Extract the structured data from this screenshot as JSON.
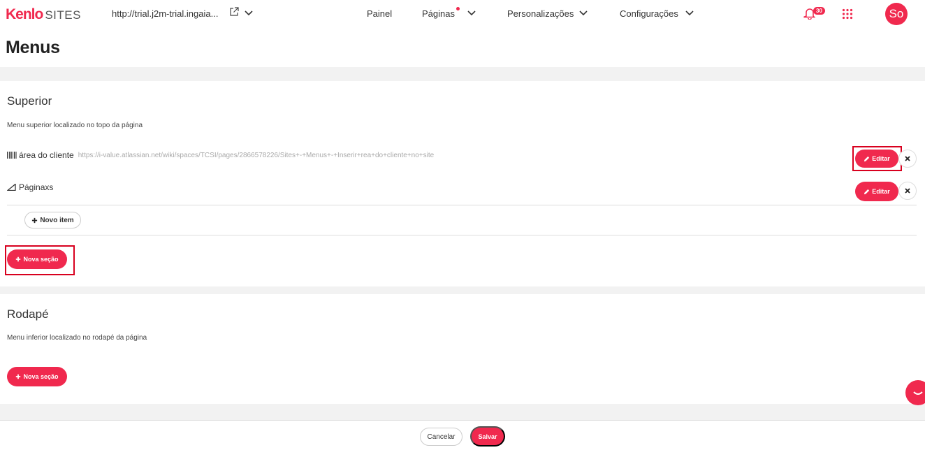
{
  "header": {
    "logo_brand": "Kenlo",
    "logo_product": "SITES",
    "site_url": "http://trial.j2m-trial.ingaia...",
    "nav": {
      "painel": "Painel",
      "paginas": "Páginas",
      "personalizacoes": "Personalizações",
      "configuracoes": "Configurações"
    },
    "notifications_count": "30",
    "avatar_initials": "So",
    "accent_color": "#f0294e"
  },
  "page": {
    "title": "Menus"
  },
  "superior": {
    "title": "Superior",
    "description": "Menu superior localizado no topo da página",
    "items": [
      {
        "label": "área do cliente",
        "link": "https://i-value.atlassian.net/wiki/spaces/TCSI/pages/2866578226/Sites+-+Menus+-+Inserir+rea+do+cliente+no+site",
        "icon": "barcode-icon",
        "edit_label": "Editar"
      },
      {
        "label": "Páginaxs",
        "link": "",
        "icon": "triangle-ruler-icon",
        "edit_label": "Editar"
      }
    ],
    "new_item_label": "Novo item",
    "new_section_label": "Nova seção"
  },
  "rodape": {
    "title": "Rodapé",
    "description": "Menu inferior localizado no rodapé da página",
    "new_section_label": "Nova seção"
  },
  "footer": {
    "cancel_label": "Cancelar",
    "save_label": "Salvar"
  }
}
